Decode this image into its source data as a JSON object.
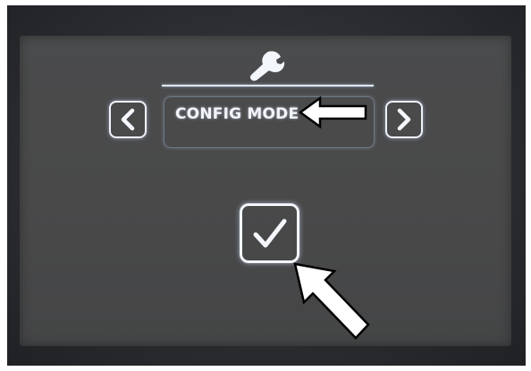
{
  "screen": {
    "top_icon": "wrench-icon",
    "mode_label": "CONFIG MODE",
    "prev_icon": "chevron-left-icon",
    "next_icon": "chevron-right-icon",
    "confirm_icon": "checkmark-icon"
  },
  "annotations": {
    "arrow_icon": "pointer-arrow-icon"
  },
  "colors": {
    "screen_bg": "#49494a",
    "glow": "#eef3fb",
    "bezel": "#2a2c30",
    "annotation_fill": "#ffffff",
    "annotation_stroke": "#000000"
  }
}
